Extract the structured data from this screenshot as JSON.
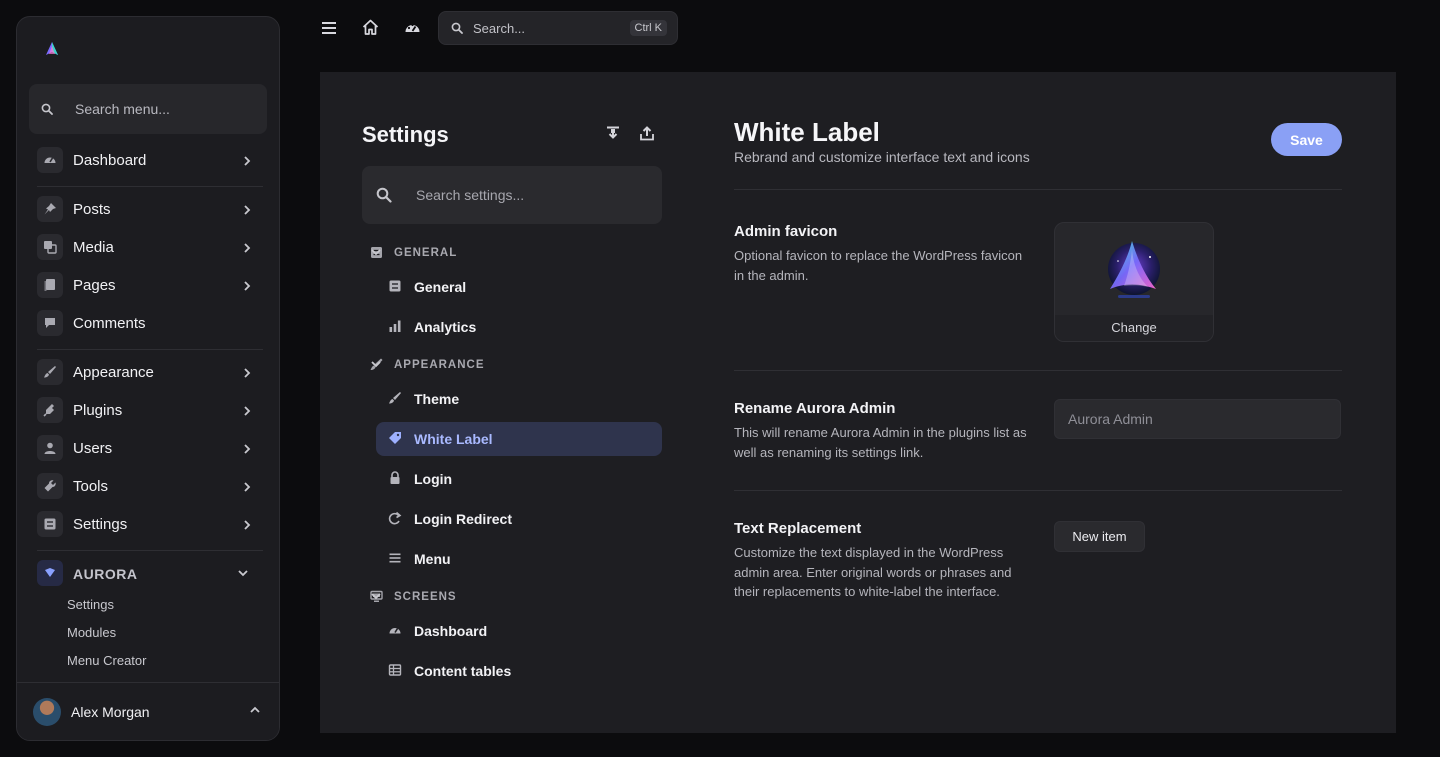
{
  "sidebar": {
    "search_placeholder": "Search menu...",
    "items": [
      {
        "label": "Dashboard",
        "icon": "dashboard-icon",
        "has_children": true
      },
      {
        "label": "Posts",
        "icon": "pin-icon",
        "has_children": true
      },
      {
        "label": "Media",
        "icon": "media-icon",
        "has_children": true
      },
      {
        "label": "Pages",
        "icon": "pages-icon",
        "has_children": true
      },
      {
        "label": "Comments",
        "icon": "comment-icon",
        "has_children": false
      },
      {
        "label": "Appearance",
        "icon": "brush-icon",
        "has_children": true
      },
      {
        "label": "Plugins",
        "icon": "plug-icon",
        "has_children": true
      },
      {
        "label": "Users",
        "icon": "user-icon",
        "has_children": true
      },
      {
        "label": "Tools",
        "icon": "wrench-icon",
        "has_children": true
      },
      {
        "label": "Settings",
        "icon": "settings-icon",
        "has_children": true
      }
    ],
    "aurora": {
      "label": "AURORA",
      "sub_items": [
        "Settings",
        "Modules",
        "Menu Creator"
      ]
    },
    "user": {
      "name": "Alex Morgan"
    }
  },
  "topbar": {
    "search_placeholder": "Search...",
    "shortcut": "Ctrl K"
  },
  "settings_nav": {
    "title": "Settings",
    "search_placeholder": "Search settings...",
    "groups": [
      {
        "label": "GENERAL",
        "items": [
          "General",
          "Analytics"
        ]
      },
      {
        "label": "APPEARANCE",
        "items": [
          "Theme",
          "White Label",
          "Login",
          "Login Redirect",
          "Menu"
        ]
      },
      {
        "label": "SCREENS",
        "items": [
          "Dashboard",
          "Content tables"
        ]
      }
    ],
    "active_item": "White Label"
  },
  "page": {
    "title": "White Label",
    "subtitle": "Rebrand and customize interface text and icons",
    "save_label": "Save",
    "sections": {
      "favicon": {
        "title": "Admin favicon",
        "description": "Optional favicon to replace the WordPress favicon in the admin.",
        "change_label": "Change"
      },
      "rename": {
        "title": "Rename Aurora Admin",
        "description": "This will rename Aurora Admin in the plugins list as well as renaming its settings link.",
        "placeholder": "Aurora Admin"
      },
      "text_replacement": {
        "title": "Text Replacement",
        "description": "Customize the text displayed in the WordPress admin area. Enter original words or phrases and their replacements to white-label the interface.",
        "button_label": "New item"
      }
    }
  },
  "colors": {
    "accent": "#8aa0f5",
    "active_bg": "#2f344d",
    "panel_bg": "#1e1e22",
    "page_bg": "#0c0c0e"
  }
}
